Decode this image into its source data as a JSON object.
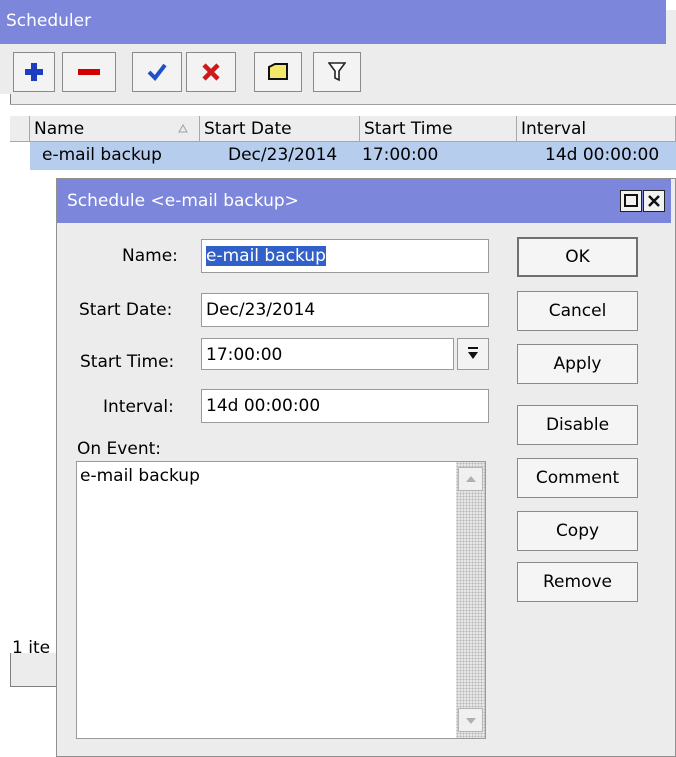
{
  "scheduler": {
    "title": "Scheduler",
    "toolbar": [
      "add-icon",
      "remove-icon",
      "enable-icon",
      "disable-icon",
      "comment-icon",
      "filter-icon"
    ],
    "columns": {
      "name": "Name",
      "start_date": "Start Date",
      "start_time": "Start Time",
      "interval": "Interval"
    },
    "rows": [
      {
        "name": "e-mail backup",
        "start_date": "Dec/23/2014",
        "start_time": "17:00:00",
        "interval": "14d 00:00:00"
      }
    ],
    "status": "1 ite"
  },
  "dialog": {
    "title": "Schedule <e-mail backup>",
    "name_label": "Name:",
    "name_value": "e-mail backup",
    "start_date_label": "Start Date:",
    "start_date_value": "Dec/23/2014",
    "start_time_label": "Start Time:",
    "start_time_value": "17:00:00",
    "interval_label": "Interval:",
    "interval_value": "14d 00:00:00",
    "on_event_label": "On Event:",
    "on_event_value": "e-mail backup",
    "buttons": {
      "ok": "OK",
      "cancel": "Cancel",
      "apply": "Apply",
      "disable": "Disable",
      "comment": "Comment",
      "copy": "Copy",
      "remove": "Remove"
    }
  },
  "colors": {
    "title_bar": "#7c86db",
    "selection": "#b7cdee",
    "add": "#1e3ec0",
    "remove": "#d40000",
    "enable": "#1f4fcc",
    "disable": "#cc1a1a",
    "comment": "#f2e96a"
  }
}
